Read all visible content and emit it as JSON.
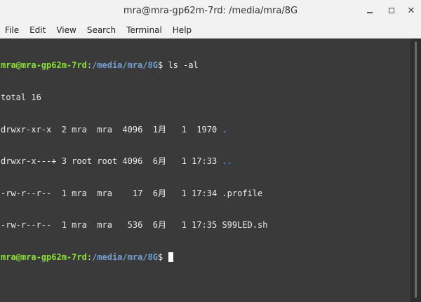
{
  "window": {
    "title": "mra@mra-gp62m-7rd: /media/mra/8G",
    "controls": {
      "minimize": "minimize",
      "maximize": "maximize",
      "close": "✕"
    }
  },
  "menubar": {
    "items": [
      "File",
      "Edit",
      "View",
      "Search",
      "Terminal",
      "Help"
    ]
  },
  "terminal": {
    "prompt_user": "mra@mra-gp62m-7rd",
    "prompt_sep": ":",
    "prompt_path": "/media/mra/8G",
    "prompt_symbol": "$ ",
    "command": "ls -al",
    "total": "total 16",
    "entries": [
      {
        "meta": "drwxr-xr-x  2 mra  mra  4096  1月   1  1970 ",
        "name": "."
      },
      {
        "meta": "drwxr-x---+ 3 root root 4096  6月   1 17:33 ",
        "name": ".."
      },
      {
        "meta": "-rw-r--r--  1 mra  mra    17  6月   1 17:34 ",
        "name": ".profile"
      },
      {
        "meta": "-rw-r--r--  1 mra  mra   536  6月   1 17:35 ",
        "name": "S99LED.sh"
      }
    ]
  },
  "colors": {
    "prompt_user": "#8ae234",
    "prompt_path": "#729fcf",
    "dir_name": "#3f8ae0",
    "terminal_bg": "#3a3a3a",
    "titlebar_bg": "#f2f2f2"
  }
}
